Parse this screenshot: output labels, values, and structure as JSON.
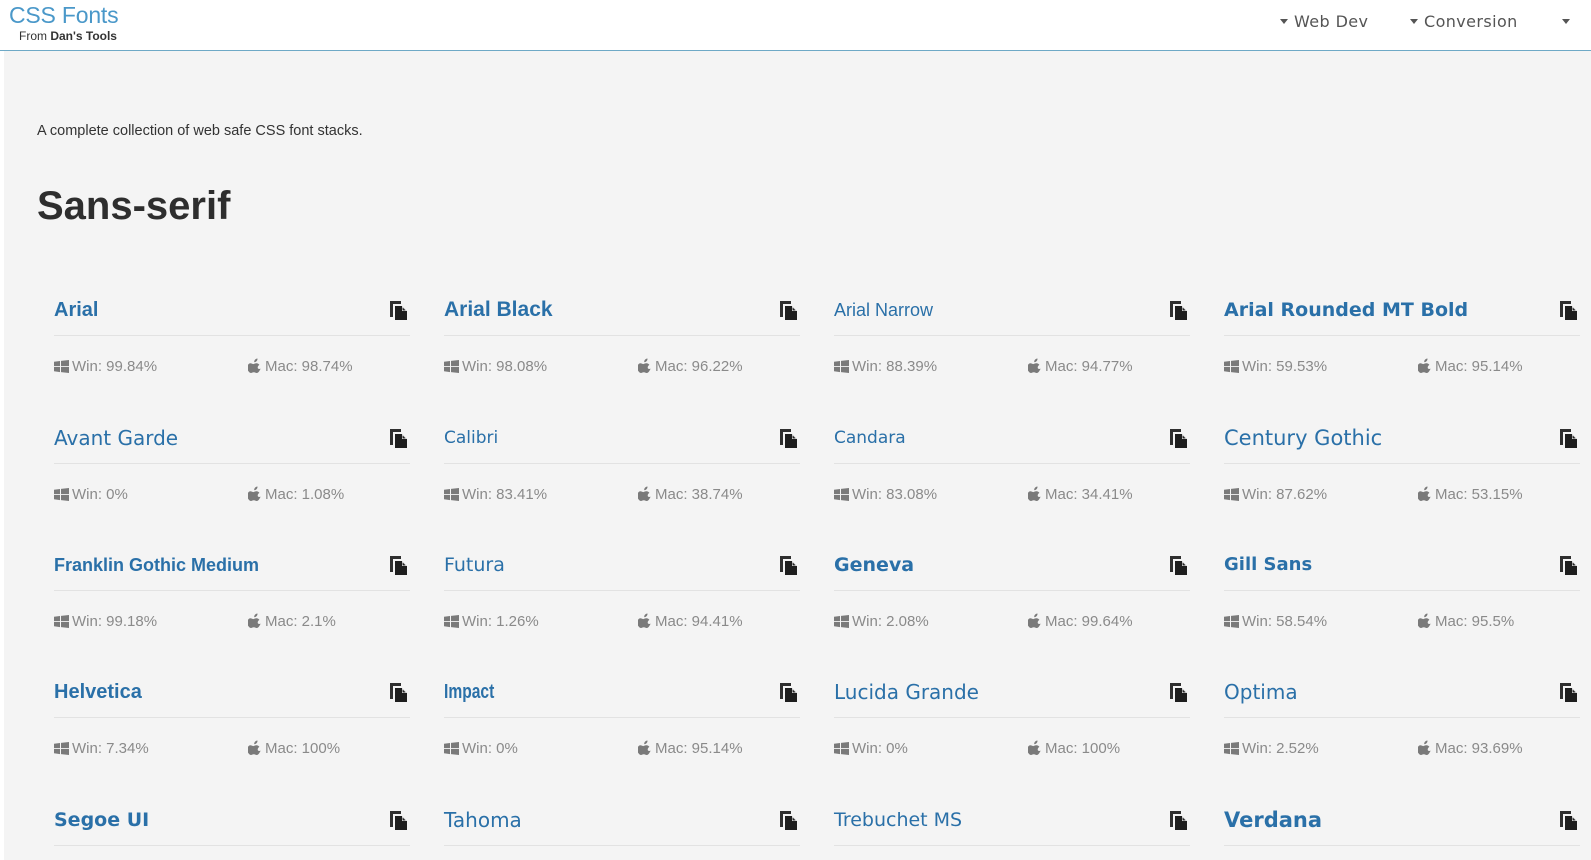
{
  "header": {
    "title": "CSS Fonts",
    "subtitle_prefix": "From",
    "subtitle_brand": "Dan's Tools",
    "nav": [
      {
        "label": "Web Dev"
      },
      {
        "label": "Conversion"
      }
    ]
  },
  "intro": "A complete collection of web safe CSS font stacks.",
  "section": {
    "title": "Sans-serif"
  },
  "fonts": [
    {
      "name": "Arial",
      "win": "Win: 99.84%",
      "mac": "Mac: 98.74%"
    },
    {
      "name": "Arial Black",
      "win": "Win: 98.08%",
      "mac": "Mac: 96.22%"
    },
    {
      "name": "Arial Narrow",
      "win": "Win: 88.39%",
      "mac": "Mac: 94.77%"
    },
    {
      "name": "Arial Rounded MT Bold",
      "win": "Win: 59.53%",
      "mac": "Mac: 95.14%"
    },
    {
      "name": "Avant Garde",
      "win": "Win: 0%",
      "mac": "Mac: 1.08%"
    },
    {
      "name": "Calibri",
      "win": "Win: 83.41%",
      "mac": "Mac: 38.74%"
    },
    {
      "name": "Candara",
      "win": "Win: 83.08%",
      "mac": "Mac: 34.41%"
    },
    {
      "name": "Century Gothic",
      "win": "Win: 87.62%",
      "mac": "Mac: 53.15%"
    },
    {
      "name": "Franklin Gothic Medium",
      "win": "Win: 99.18%",
      "mac": "Mac: 2.1%"
    },
    {
      "name": "Futura",
      "win": "Win: 1.26%",
      "mac": "Mac: 94.41%"
    },
    {
      "name": "Geneva",
      "win": "Win: 2.08%",
      "mac": "Mac: 99.64%"
    },
    {
      "name": "Gill Sans",
      "win": "Win: 58.54%",
      "mac": "Mac: 95.5%"
    },
    {
      "name": "Helvetica",
      "win": "Win: 7.34%",
      "mac": "Mac: 100%"
    },
    {
      "name": "Impact",
      "win": "Win: 0%",
      "mac": "Mac: 95.14%"
    },
    {
      "name": "Lucida Grande",
      "win": "Win: 0%",
      "mac": "Mac: 100%"
    },
    {
      "name": "Optima",
      "win": "Win: 2.52%",
      "mac": "Mac: 93.69%"
    },
    {
      "name": "Segoe UI"
    },
    {
      "name": "Tahoma"
    },
    {
      "name": "Trebuchet MS"
    },
    {
      "name": "Verdana"
    }
  ],
  "icons": {
    "copy": "copy-icon",
    "windows": "windows-icon",
    "apple": "apple-icon",
    "caret": "caret-down-icon"
  },
  "colors": {
    "brand": "#4a98c9",
    "font_link": "#2a70a8",
    "stat_text": "#8a8a8a",
    "background": "#f4f4f4"
  }
}
